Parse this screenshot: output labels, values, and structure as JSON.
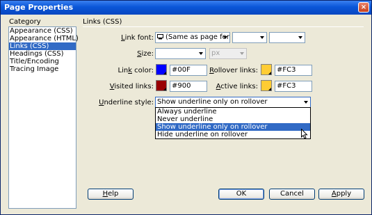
{
  "window": {
    "title": "Page Properties",
    "close_glyph": "×"
  },
  "category": {
    "header": "Category",
    "items": [
      {
        "label": "Appearance (CSS)"
      },
      {
        "label": "Appearance (HTML)"
      },
      {
        "label": "Links (CSS)"
      },
      {
        "label": "Headings (CSS)"
      },
      {
        "label": "Title/Encoding"
      },
      {
        "label": "Tracing Image"
      }
    ]
  },
  "section_title": "Links (CSS)",
  "link_font": {
    "label_accel": "L",
    "label_rest": "ink font:",
    "value": "(Same as page font)",
    "extra1": "",
    "extra2": ""
  },
  "size": {
    "label_accel": "S",
    "label_rest": "ize:",
    "value": "",
    "unit": "px"
  },
  "link_color": {
    "label_pre": "Lin",
    "label_accel": "k",
    "label_post": " color:",
    "value": "#00F",
    "swatch": "#0000ff"
  },
  "rollover_links": {
    "label_accel": "R",
    "label_rest": "ollover links:",
    "value": "#FC3",
    "swatch": "#ffcc33"
  },
  "visited_links": {
    "label_accel": "V",
    "label_rest": "isited links:",
    "value": "#900",
    "swatch": "#990000"
  },
  "active_links": {
    "label_accel": "A",
    "label_rest": "ctive links:",
    "value": "#FC3",
    "swatch": "#ffcc33"
  },
  "underline_style": {
    "label_accel": "U",
    "label_rest": "nderline style:",
    "value": "Show underline only on rollover",
    "options": [
      {
        "label": "Always underline"
      },
      {
        "label": "Never underline"
      },
      {
        "label": "Show underline only on rollover"
      },
      {
        "label": "Hide underline on rollover"
      }
    ]
  },
  "buttons": {
    "help_accel": "H",
    "help_rest": "elp",
    "ok": "OK",
    "cancel": "Cancel",
    "apply_accel": "A",
    "apply_rest": "pply"
  },
  "icons": {
    "font": "computer-icon",
    "pointer": "mouse-pointer-icon"
  }
}
